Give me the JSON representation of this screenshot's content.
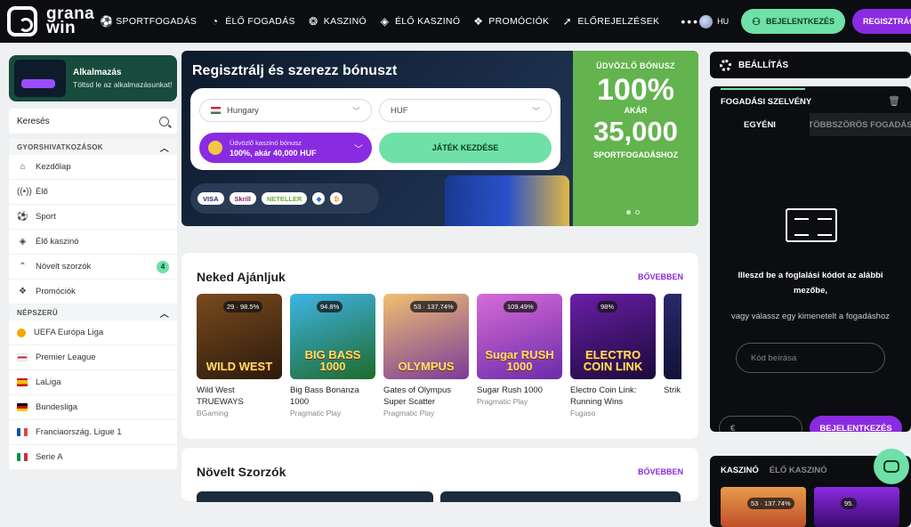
{
  "header": {
    "logo_text_1": "grana",
    "logo_text_2": "win",
    "nav": [
      {
        "label": "SPORTFOGADÁS",
        "icon": "soccer-ball-icon"
      },
      {
        "label": "ÉLŐ FOGADÁS",
        "icon": "live-fire-icon"
      },
      {
        "label": "KASZINÓ",
        "icon": "casino-chip-icon"
      },
      {
        "label": "ÉLŐ KASZINÓ",
        "icon": "live-casino-icon"
      },
      {
        "label": "PROMÓCIÓK",
        "icon": "gift-icon"
      },
      {
        "label": "ELŐREJELZÉSEK",
        "icon": "cursor-icon"
      }
    ],
    "more": "•••",
    "lang": "HU",
    "login": "BEJELENTKEZÉS",
    "register": "REGISZTRÁCIÓ"
  },
  "sidebar": {
    "app_title": "Alkalmazás",
    "app_sub": "Töltsd le az alkalmazásunkat!",
    "search_placeholder": "Keresés",
    "quick_header": "GYORSHIVATKOZÁSOK",
    "quick": [
      {
        "label": "Kezdőlap",
        "icon": "home-icon"
      },
      {
        "label": "Élő",
        "icon": "live-signal-icon"
      },
      {
        "label": "Sport",
        "icon": "soccer-ball-icon"
      },
      {
        "label": "Élő kaszinó",
        "icon": "live-casino-icon"
      },
      {
        "label": "Növelt szorzók",
        "icon": "boost-arrows-icon",
        "badge": "4"
      },
      {
        "label": "Promóciók",
        "icon": "gift-icon"
      }
    ],
    "popular_header": "NÉPSZERŰ",
    "popular": [
      {
        "label": "UEFA Európa Liga",
        "flag": "#f2a900"
      },
      {
        "label": "Premier League",
        "flag": "#cf142b"
      },
      {
        "label": "LaLiga",
        "flag": "#f1bf00"
      },
      {
        "label": "Bundesliga",
        "flag": "#000000"
      },
      {
        "label": "Franciaország. Ligue 1",
        "flag": "#0055a4"
      },
      {
        "label": "Serie A",
        "flag": "#009246"
      }
    ]
  },
  "hero": {
    "title": "Regisztrálj és szerezz bónuszt",
    "country": "Hungary",
    "currency": "HUF",
    "bonus_line1": "Üdvözlő kaszinó bónusz",
    "bonus_line2": "100%, akár 40,000 HUF",
    "play": "JÁTÉK KEZDÉSE",
    "payments": [
      "VISA",
      "Skrill",
      "NETELLER"
    ],
    "promo_t1": "ÜDVÖZLŐ BÓNUSZ",
    "promo_pct": "100%",
    "promo_akar": "AKÁR",
    "promo_amt": "35,000",
    "promo_t2": "SPORTFOGADÁSHOZ"
  },
  "recommended": {
    "title": "Neked Ajánljuk",
    "more": "BŐVEBBEN",
    "games": [
      {
        "title": "Wild West TRUEWAYS",
        "provider": "BGaming",
        "stat": "29 · 98.5%",
        "art": "WILD WEST",
        "c1": "#7a4a1e",
        "c2": "#2b1a0c"
      },
      {
        "title": "Big Bass Bonanza 1000",
        "provider": "Pragmatic Play",
        "stat": "94.8%",
        "art": "BIG BASS 1000",
        "c1": "#3fb4e6",
        "c2": "#1e6b2b"
      },
      {
        "title": "Gates of Olympus Super Scatter",
        "provider": "Pragmatic Play",
        "stat": "53 · 137.74%",
        "art": "OLYMPUS",
        "c1": "#f0c070",
        "c2": "#7a3b9a"
      },
      {
        "title": "Sugar Rush 1000",
        "provider": "Pragmatic Play",
        "stat": "109.49%",
        "art": "Sugar RUSH 1000",
        "c1": "#d86bd8",
        "c2": "#6a2ca8"
      },
      {
        "title": "Electro Coin Link: Running Wins",
        "provider": "Fugaso",
        "stat": "98%",
        "art": "ELECTRO COIN LINK",
        "c1": "#6a1ea8",
        "c2": "#1a0a3a"
      },
      {
        "title": "Strik",
        "provider": "",
        "stat": "",
        "art": "",
        "c1": "#2a2a6a",
        "c2": "#0a0a2a"
      }
    ]
  },
  "boosted": {
    "title": "Növelt Szorzók",
    "more": "BŐVEBBEN"
  },
  "right": {
    "settings": "BEÁLLÍTÁS",
    "slip_title": "FOGADÁSI SZELVÉNY",
    "tab_single": "EGYÉNI",
    "tab_multi": "TÖBBSZÖRÖS FOGADÁS",
    "msg1": "Illeszd be a foglalási kódot az alábbi mezőbe,",
    "msg2": "vagy válassz egy kimenetelt a fogadáshoz",
    "code_placeholder": "Kód beírása",
    "amount_placeholder": "€",
    "login": "BEJELENTKEZÉS",
    "casino_tab": "KASZINÓ",
    "live_casino_tab": "ÉLŐ KASZINÓ",
    "mini_stat_1": "53 · 137.74%",
    "mini_stat_2": "95."
  },
  "colors": {
    "accent_green": "#6fe0a7",
    "accent_purple": "#8a2be2",
    "promo_green": "#63b34e",
    "dark": "#0b0d10"
  }
}
